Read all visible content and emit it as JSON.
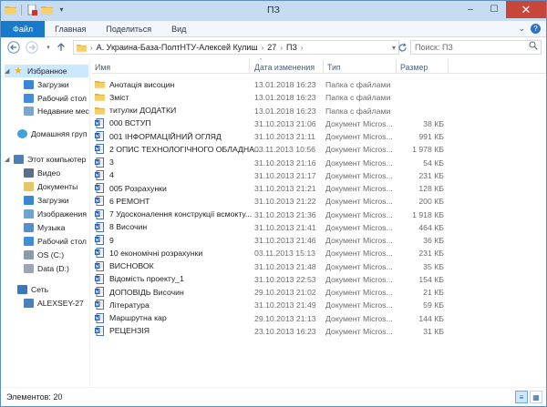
{
  "window": {
    "title": "ПЗ"
  },
  "ribbon": {
    "tabs": [
      "Файл",
      "Главная",
      "Поделиться",
      "Вид"
    ]
  },
  "address": {
    "segments": [
      "A. Украина-База-ПолтНТУ-Алексей Кулиш",
      "27",
      "ПЗ"
    ],
    "search_placeholder": "Поиск: ПЗ"
  },
  "columns": {
    "name": "Имя",
    "date": "Дата изменения",
    "type": "Тип",
    "size": "Размер"
  },
  "nav": {
    "favorites": "Избранное",
    "downloads": "Загрузки",
    "desktop": "Рабочий стол",
    "recent": "Недавние мес",
    "homegroup": "Домашняя груп",
    "computer": "Этот компьютер",
    "video": "Видео",
    "documents": "Документы",
    "downloads2": "Загрузки",
    "images": "Изображения",
    "music": "Музыка",
    "desktop2": "Рабочий стол",
    "osc": "OS (C:)",
    "datad": "Data (D:)",
    "network": "Сеть",
    "alexsey": "ALEXSEY-27"
  },
  "files": [
    {
      "name": "Анотація висоцин",
      "date": "13.01.2018 16:23",
      "type": "Папка с файлами",
      "size": "",
      "kind": "folder"
    },
    {
      "name": "Зміст",
      "date": "13.01.2018 16:23",
      "type": "Папка с файлами",
      "size": "",
      "kind": "folder"
    },
    {
      "name": "титулки ДОДАТКИ",
      "date": "13.01.2018 16:23",
      "type": "Папка с файлами",
      "size": "",
      "kind": "folder"
    },
    {
      "name": "000 ВСТУП",
      "date": "31.10.2013 21:06",
      "type": "Документ Micros...",
      "size": "38 КБ",
      "kind": "doc"
    },
    {
      "name": "001 ІНФОРМАЦІЙНИЙ ОГЛЯД",
      "date": "31.10.2013 21:11",
      "type": "Документ Micros...",
      "size": "991 КБ",
      "kind": "doc"
    },
    {
      "name": "2 ОПИС ТЕХНОЛОГІЧНОГО ОБЛАДНА...",
      "date": "03.11.2013 10:56",
      "type": "Документ Micros...",
      "size": "1 978 КБ",
      "kind": "doc"
    },
    {
      "name": "3",
      "date": "31.10.2013 21:16",
      "type": "Документ Micros...",
      "size": "54 КБ",
      "kind": "doc"
    },
    {
      "name": "4",
      "date": "31.10.2013 21:17",
      "type": "Документ Micros...",
      "size": "231 КБ",
      "kind": "doc"
    },
    {
      "name": "005 Розрахунки",
      "date": "31.10.2013 21:21",
      "type": "Документ Micros...",
      "size": "128 КБ",
      "kind": "doc"
    },
    {
      "name": "6 РЕМОНТ",
      "date": "31.10.2013 21:22",
      "type": "Документ Micros...",
      "size": "200 КБ",
      "kind": "doc"
    },
    {
      "name": "7 Удосконалення конструкції всмокту...",
      "date": "31.10.2013 21:36",
      "type": "Документ Micros...",
      "size": "1 918 КБ",
      "kind": "doc"
    },
    {
      "name": "8 Височин",
      "date": "31.10.2013 21:41",
      "type": "Документ Micros...",
      "size": "464 КБ",
      "kind": "doc"
    },
    {
      "name": "9",
      "date": "31.10.2013 21:46",
      "type": "Документ Micros...",
      "size": "36 КБ",
      "kind": "doc"
    },
    {
      "name": "10 економічні розрахунки",
      "date": "03.11.2013 15:13",
      "type": "Документ Micros...",
      "size": "231 КБ",
      "kind": "doc"
    },
    {
      "name": "ВИСНОВОК",
      "date": "31.10.2013 21:48",
      "type": "Документ Micros...",
      "size": "35 КБ",
      "kind": "doc"
    },
    {
      "name": "Відомість проекту_1",
      "date": "31.10.2013 22:53",
      "type": "Документ Micros...",
      "size": "154 КБ",
      "kind": "doc"
    },
    {
      "name": "ДОПОВІДЬ Височин",
      "date": "29.10.2013 21:02",
      "type": "Документ Micros...",
      "size": "21 КБ",
      "kind": "doc"
    },
    {
      "name": "Література",
      "date": "31.10.2013 21:49",
      "type": "Документ Micros...",
      "size": "59 КБ",
      "kind": "doc"
    },
    {
      "name": "Маршрутна кар",
      "date": "29.10.2013 21:13",
      "type": "Документ Micros...",
      "size": "144 КБ",
      "kind": "doc"
    },
    {
      "name": "РЕЦЕНЗІЯ",
      "date": "23.10.2013 16:23",
      "type": "Документ Micros...",
      "size": "31 КБ",
      "kind": "doc"
    }
  ],
  "status": {
    "count": "Элементов: 20"
  }
}
